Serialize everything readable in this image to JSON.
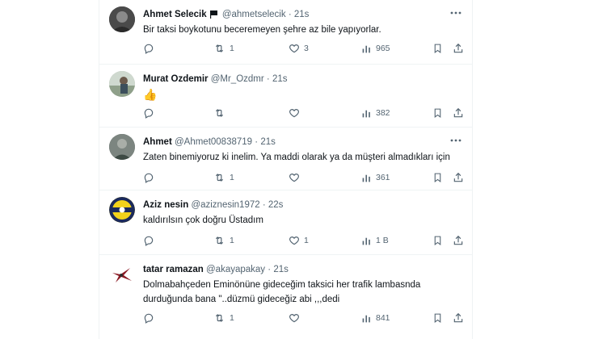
{
  "tweets": [
    {
      "name": "Ahmet Selecik",
      "handle": "@ahmetselecik",
      "dot": "·",
      "time": "21s",
      "text": "Bir taksi boykotunu beceremeyen şehre az bile yapıyorlar.",
      "replies": "",
      "retweets": "1",
      "likes": "3",
      "views": "965",
      "flag_icon": "black-flag-icon"
    },
    {
      "name": "Murat Ozdemir",
      "handle": "@Mr_Ozdmr",
      "dot": "·",
      "time": "21s",
      "text": "👍",
      "replies": "",
      "retweets": "",
      "likes": "",
      "views": "382"
    },
    {
      "name": "Ahmet",
      "handle": "@Ahmet00838719",
      "dot": "·",
      "time": "21s",
      "text": "Zaten binemiyoruz ki inelim. Ya maddi olarak ya da müşteri almadıkları için",
      "replies": "",
      "retweets": "1",
      "likes": "",
      "views": "361"
    },
    {
      "name": "Aziz nesin",
      "handle": "@aziznesin1972",
      "dot": "·",
      "time": "22s",
      "text": "kaldırılsın çok doğru Üstadım",
      "replies": "",
      "retweets": "1",
      "likes": "1",
      "views": "1 B"
    },
    {
      "name": "tatar ramazan",
      "handle": "@akayapakay",
      "dot": "·",
      "time": "21s",
      "text": "Dolmabahçeden Eminönüne gideceğim taksici her trafik lambasnda durduğunda bana \"..düzmü gideceğiz abi ,,,dedi",
      "replies": "",
      "retweets": "1",
      "likes": "",
      "views": "841"
    }
  ],
  "colors": {
    "text_primary": "#0f1419",
    "text_secondary": "#536471",
    "divider": "#eff3f4"
  }
}
